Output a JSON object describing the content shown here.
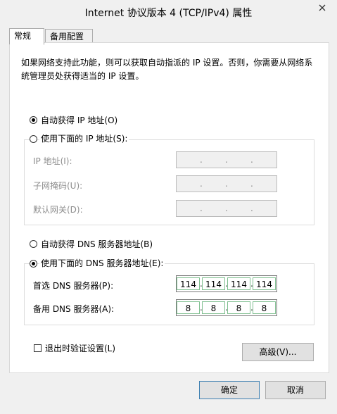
{
  "window": {
    "title": "Internet 协议版本 4 (TCP/IPv4) 属性"
  },
  "tabs": [
    {
      "label": "常规",
      "active": true
    },
    {
      "label": "备用配置",
      "active": false
    }
  ],
  "description": "如果网络支持此功能，则可以获取自动指派的 IP 设置。否则，你需要从网络系统管理员处获得适当的 IP 设置。",
  "ip": {
    "auto_label": "自动获得 IP 地址(O)",
    "auto_checked": true,
    "manual_label": "使用下面的 IP 地址(S):",
    "manual_checked": false,
    "fields": [
      {
        "label": "IP 地址(I):",
        "segments": [
          "",
          "",
          "",
          ""
        ]
      },
      {
        "label": "子网掩码(U):",
        "segments": [
          "",
          "",
          "",
          ""
        ]
      },
      {
        "label": "默认网关(D):",
        "segments": [
          "",
          "",
          "",
          ""
        ]
      }
    ]
  },
  "dns": {
    "auto_label": "自动获得 DNS 服务器地址(B)",
    "auto_checked": false,
    "manual_label": "使用下面的 DNS 服务器地址(E):",
    "manual_checked": true,
    "fields": [
      {
        "label": "首选 DNS 服务器(P):",
        "segments": [
          "114",
          "114",
          "114",
          "114"
        ]
      },
      {
        "label": "备用 DNS 服务器(A):",
        "segments": [
          "8",
          "8",
          "8",
          "8"
        ]
      }
    ]
  },
  "validate_label": "退出时验证设置(L)",
  "validate_checked": false,
  "advanced_label": "高级(V)...",
  "ok_label": "确定",
  "cancel_label": "取消",
  "dot": "."
}
